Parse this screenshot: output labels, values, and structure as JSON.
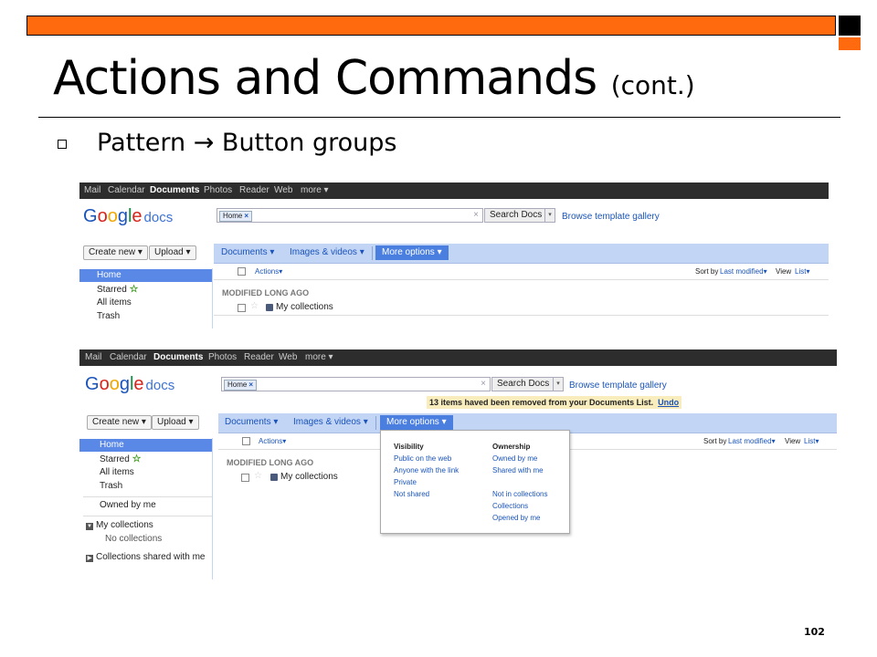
{
  "slide": {
    "title": "Actions and Commands",
    "title_suffix": "(cont.)",
    "bullet": "Pattern → Button groups",
    "page_number": "102"
  },
  "gbar": {
    "items": [
      "Mail",
      "Calendar",
      "Documents",
      "Photos",
      "Reader",
      "Web",
      "more ▾"
    ]
  },
  "logo": {
    "google": "Google",
    "product": "docs"
  },
  "search": {
    "chip": "Home",
    "chip_close": "×",
    "clear": "×",
    "button": "Search Docs",
    "dropdown": "▾",
    "template_link": "Browse template gallery"
  },
  "left_buttons": {
    "create": "Create new ▾",
    "upload": "Upload ▾"
  },
  "toolbar": {
    "documents": "Documents ▾",
    "images": "Images & videos ▾",
    "more": "More options ▾"
  },
  "nav": {
    "home": "Home",
    "starred": "Starred",
    "star": "☆",
    "all": "All items",
    "trash": "Trash",
    "owned": "Owned by me",
    "my_collections": "My collections",
    "no_collections": "No collections",
    "shared_collections": "Collections shared with me"
  },
  "list": {
    "actions": "Actions▾",
    "sort_by": "Sort by",
    "sort_value": "Last modified▾",
    "view": "View",
    "view_value": "List▾",
    "section": "MODIFIED LONG AGO",
    "item": "My collections"
  },
  "notice": {
    "text": "13 items haved been removed from your Documents List.",
    "undo": "Undo"
  },
  "menu": {
    "visibility_header": "Visibility",
    "visibility": [
      "Public on the web",
      "Anyone with the link",
      "Private",
      "Not shared"
    ],
    "ownership_header": "Ownership",
    "ownership": [
      "Owned by me",
      "Shared with me"
    ],
    "other": [
      "Not in collections",
      "Collections",
      "Opened by me"
    ]
  },
  "colors": {
    "accent_orange": "#ff6a0e",
    "toolbar_blue": "#c3d5f5",
    "selected_blue": "#5a88e6",
    "link_blue": "#1a54ba"
  }
}
